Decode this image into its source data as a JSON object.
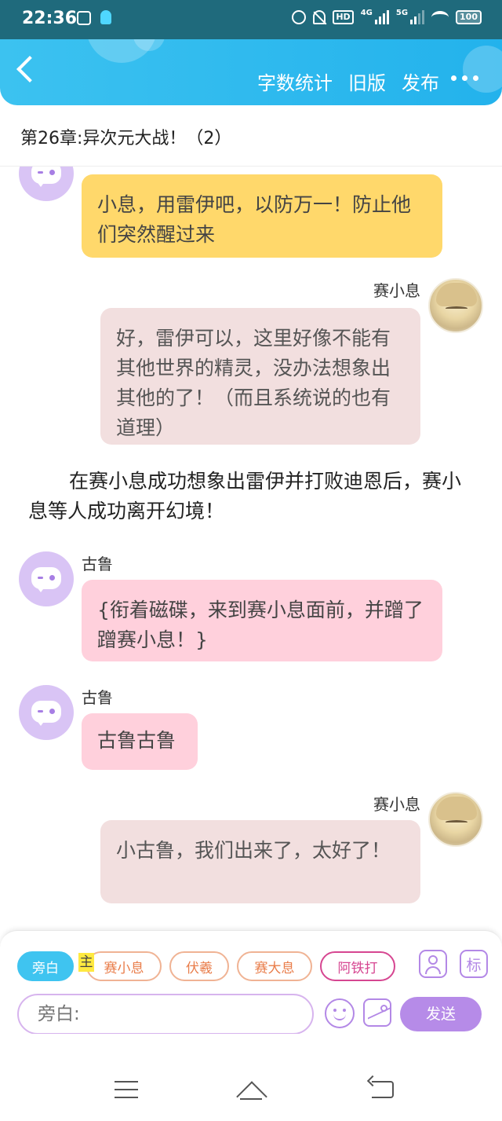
{
  "status_bar": {
    "time": "22:36",
    "hd_label": "HD",
    "network_label": "4G",
    "network2_label": "5G",
    "battery": "100"
  },
  "header": {
    "actions": [
      "字数统计",
      "旧版",
      "发布"
    ]
  },
  "chapter": {
    "title": "第26章:异次元大战！（2）"
  },
  "messages": [
    {
      "side": "left",
      "sender": "",
      "color": "yellow",
      "text": "小息，用雷伊吧，以防万一！防止他们突然醒过来"
    },
    {
      "side": "right",
      "sender": "赛小息",
      "color": "grey",
      "text": "好，雷伊可以，这里好像不能有其他世界的精灵，没办法想象出其他的了！（而且系统说的也有道理）"
    },
    {
      "side": "narration",
      "text": "在赛小息成功想象出雷伊并打败迪恩后，赛小息等人成功离开幻境！"
    },
    {
      "side": "left",
      "sender": "古鲁",
      "color": "pink",
      "text": "{衔着磁碟，来到赛小息面前，并蹭了蹭赛小息！}"
    },
    {
      "side": "left",
      "sender": "古鲁",
      "color": "pink",
      "text": "古鲁古鲁"
    },
    {
      "side": "right",
      "sender": "赛小息",
      "color": "grey",
      "text": "小古鲁，我们出来了，太好了！"
    }
  ],
  "panel": {
    "roles": [
      "旁白",
      "赛小息",
      "伏羲",
      "赛大息",
      "阿铁打"
    ],
    "main_tag": "主",
    "mark_label": "标",
    "input_placeholder": "旁白:",
    "send_label": "发送"
  },
  "colors": {
    "accent_blue": "#3fc4f0",
    "accent_purple": "#b68be8",
    "bubble_yellow": "#ffd86b",
    "bubble_pink": "#ffd0dc",
    "bubble_grey": "#f2dfdf"
  }
}
